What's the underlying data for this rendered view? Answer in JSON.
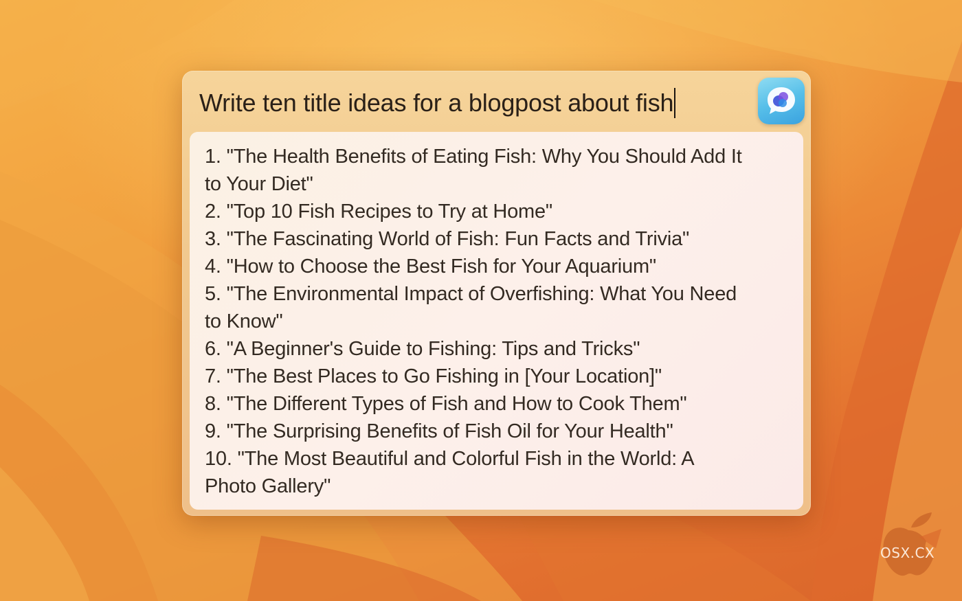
{
  "spotlight": {
    "query": "Write ten title ideas for a blogpost about fish",
    "app_icon": "chat-bubble-app-icon"
  },
  "results": {
    "lines": [
      "1. \"The Health Benefits of Eating Fish: Why You Should Add It",
      "to Your Diet\"",
      "2. \"Top 10 Fish Recipes to Try at Home\"",
      "3. \"The Fascinating World of Fish: Fun Facts and Trivia\"",
      "4. \"How to Choose the Best Fish for Your Aquarium\"",
      "5. \"The Environmental Impact of Overfishing: What You Need",
      "to Know\"",
      "6. \"A Beginner's Guide to Fishing: Tips and Tricks\"",
      "7. \"The Best Places to Go Fishing in [Your Location]\"",
      "8. \"The Different Types of Fish and How to Cook Them\"",
      "9. \"The Surprising Benefits of Fish Oil for Your Health\"",
      "10. \"The Most Beautiful and Colorful Fish in the World: A",
      "Photo Gallery\""
    ]
  },
  "watermark": {
    "text": "OSX.CX",
    "icon": "apple-logo-icon"
  },
  "colors": {
    "wallpaper_top": "#f6b24a",
    "wallpaper_bottom": "#d9652a",
    "panel": "#f1c98f",
    "results_bg": "#fbf1e4",
    "text": "#332a22",
    "icon_blue": "#57bfe9"
  }
}
